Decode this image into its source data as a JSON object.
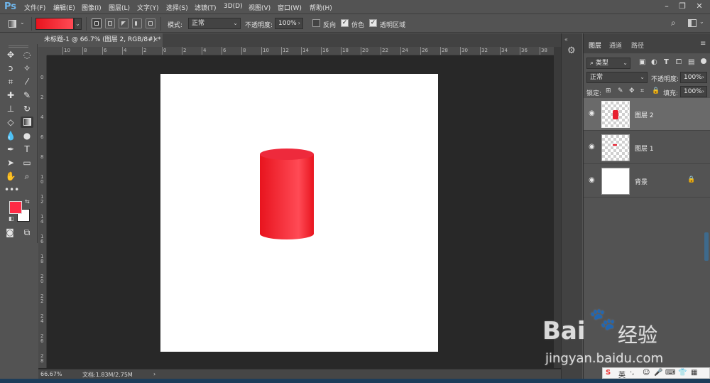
{
  "app": {
    "logo": "Ps"
  },
  "menu": [
    "文件(F)",
    "编辑(E)",
    "图像(I)",
    "图层(L)",
    "文字(Y)",
    "选择(S)",
    "滤镜(T)",
    "3D(D)",
    "视图(V)",
    "窗口(W)",
    "帮助(H)"
  ],
  "options": {
    "mode_label": "模式:",
    "mode_value": "正常",
    "opacity_label": "不透明度:",
    "opacity_value": "100%",
    "reverse_label": "反向",
    "dither_label": "仿色",
    "transparency_label": "透明区域",
    "reverse_checked": false,
    "dither_checked": true,
    "transparency_checked": true,
    "gradient_colors": [
      "#e8141e",
      "#ff4b55"
    ]
  },
  "document": {
    "tab_title": "未标题-1 @ 66.7% (图层 2, RGB/8#) *",
    "close_label": "×",
    "status_zoom": "66.67%",
    "status_doc": "文档:1.83M/2.75M",
    "status_arrow": "›"
  },
  "rulers": {
    "h_labels": [
      "10",
      "8",
      "6",
      "4",
      "2",
      "0",
      "2",
      "4",
      "6",
      "8",
      "10",
      "12",
      "14",
      "16",
      "18",
      "20",
      "22",
      "24",
      "26",
      "28",
      "30",
      "32",
      "34",
      "36",
      "38"
    ],
    "v_labels": [
      "0",
      "2",
      "4",
      "6",
      "8",
      "1\n0",
      "1\n2",
      "1\n4",
      "1\n6",
      "1\n8",
      "2\n0",
      "2\n2",
      "2\n4",
      "2\n6",
      "2\n8"
    ]
  },
  "colors": {
    "foreground": "#ff2a44",
    "background": "#ffffff",
    "cylinder": "#f0222c"
  },
  "panel": {
    "tabs": [
      "图层",
      "通道",
      "路径"
    ],
    "filter_label": "类型",
    "blend_value": "正常",
    "opacity_label": "不透明度:",
    "opacity_value": "100%",
    "lock_label": "锁定:",
    "fill_label": "填充:",
    "fill_value": "100%",
    "layers": [
      {
        "name": "图层 2",
        "selected": true,
        "transparent": true
      },
      {
        "name": "图层 1",
        "selected": false,
        "transparent": true
      },
      {
        "name": "背景",
        "selected": false,
        "transparent": false,
        "locked": true
      }
    ]
  },
  "watermark": {
    "brand": "Bai",
    "brand2": "du",
    "cn": "经验",
    "url": "jingyan.baidu.com"
  },
  "ime": {
    "label": "英"
  }
}
